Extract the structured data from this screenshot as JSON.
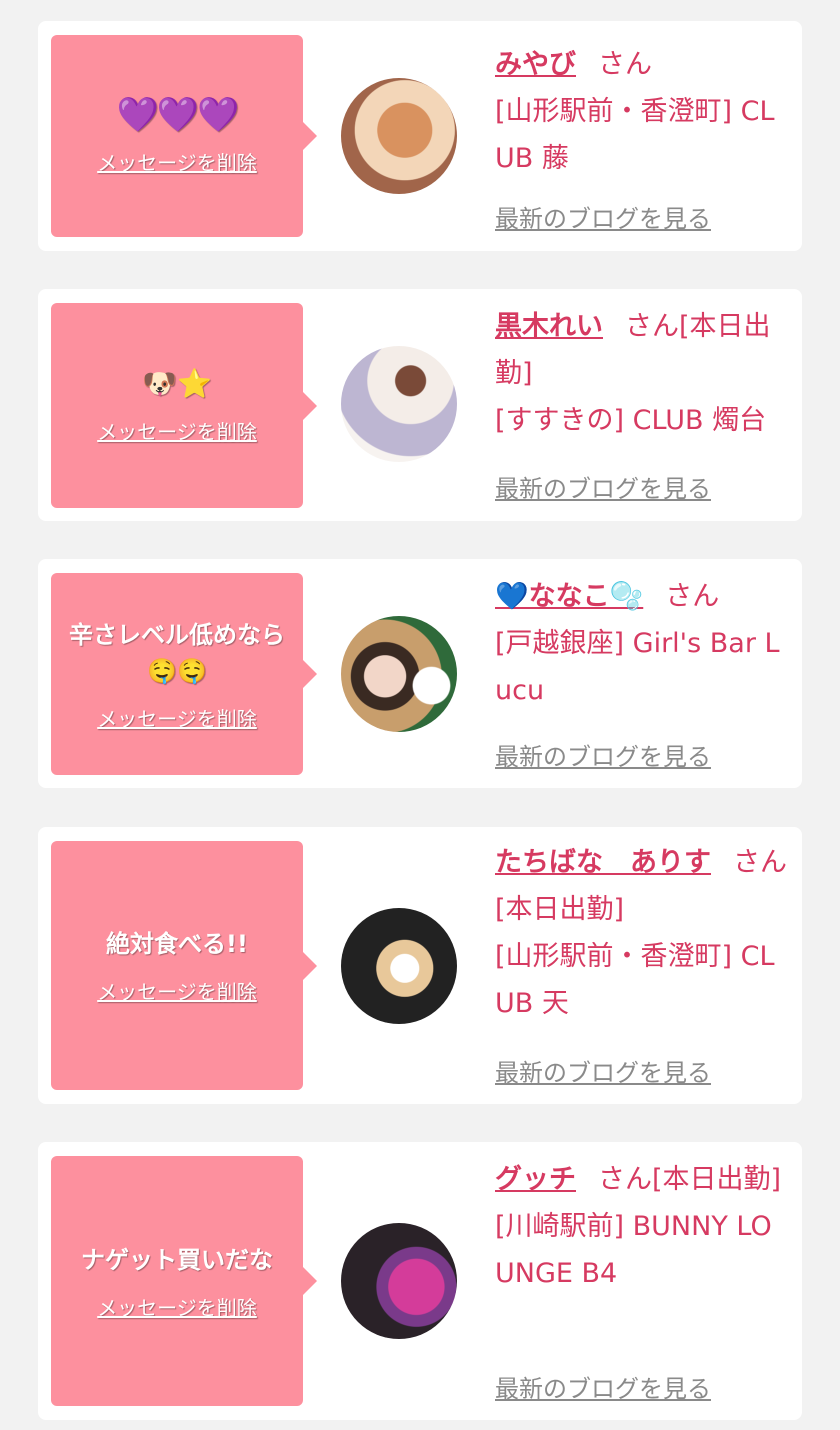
{
  "cards": [
    {
      "message": "💜💜💜",
      "delete_label": "メッセージを削除",
      "name": "みやび",
      "suffix": "さん",
      "shop": "[山形駅前・香澄町] CLUB 藤",
      "blog_label": "最新のブログを見る",
      "avatar_colors": [
        "#f2c29a",
        "#c07a5a"
      ]
    },
    {
      "message": "🐶⭐",
      "delete_label": "メッセージを削除",
      "name": "黒木れい",
      "suffix": "さん[本日出勤]",
      "shop": "[すすきの] CLUB 燭台",
      "blog_label": "最新のブログを見る",
      "avatar_colors": [
        "#f7f3f0",
        "#c5c0d8"
      ]
    },
    {
      "message": "辛さレベル低めなら🤤🤤",
      "delete_label": "メッセージを削除",
      "name": "💙ななこ🫧",
      "suffix": "さん",
      "shop": "[戸越銀座] Girl's Bar Lucu",
      "blog_label": "最新のブログを見る",
      "avatar_colors": [
        "#c9a47a",
        "#2f6a3a"
      ]
    },
    {
      "message": "絶対食べる!!",
      "delete_label": "メッセージを削除",
      "name": "たちばな　ありす",
      "suffix": "さん[本日出勤]",
      "shop": "[山形駅前・香澄町] CLUB 天",
      "blog_label": "最新のブログを見る",
      "avatar_colors": [
        "#2a2a2a",
        "#f4e6c6"
      ]
    },
    {
      "message": "ナゲット買いだな",
      "delete_label": "メッセージを削除",
      "name": "グッチ",
      "suffix": "さん[本日出勤]",
      "shop": "[川崎駅前] BUNNY LOUNGE B4",
      "blog_label": "最新のブログを見る",
      "avatar_colors": [
        "#3a2a3a",
        "#d43c9a"
      ]
    }
  ]
}
